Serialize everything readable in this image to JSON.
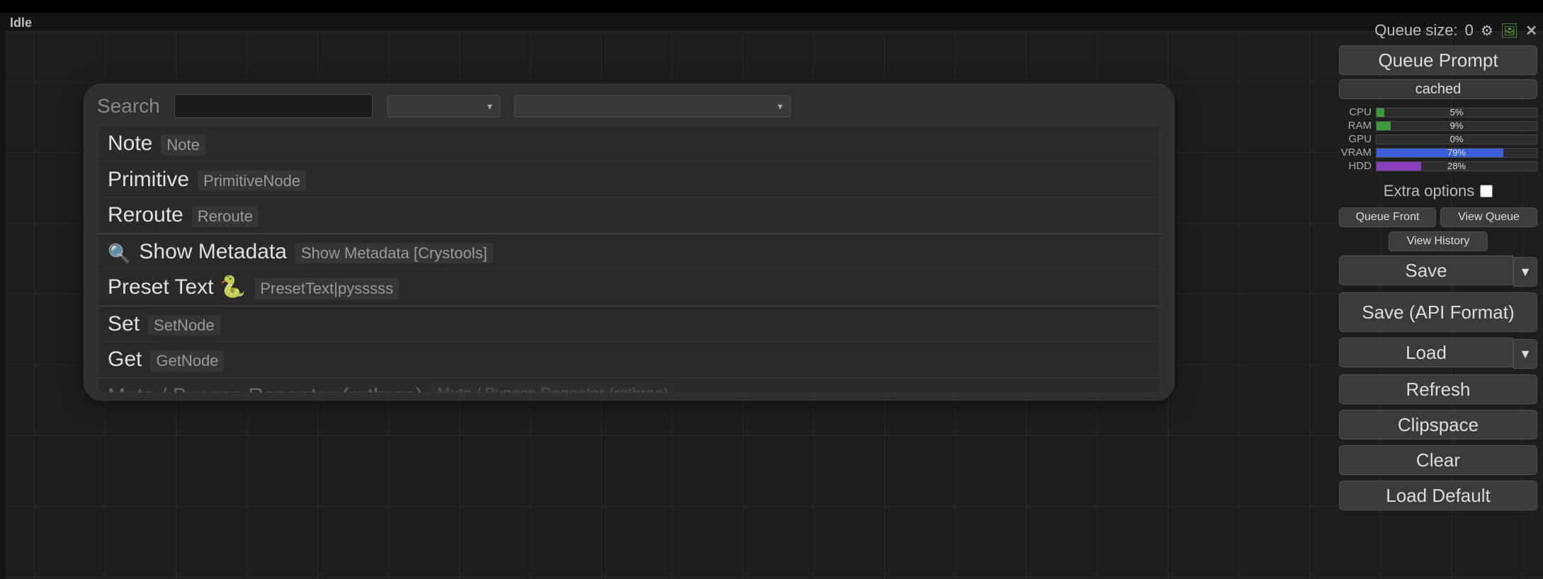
{
  "status": {
    "text": "Idle"
  },
  "search": {
    "label": "Search",
    "value": "",
    "placeholder": "",
    "results": [
      {
        "icon": "",
        "name": "Note",
        "tag": "Note",
        "divider": false
      },
      {
        "icon": "",
        "name": "Primitive",
        "tag": "PrimitiveNode",
        "divider": false
      },
      {
        "icon": "",
        "name": "Reroute",
        "tag": "Reroute",
        "divider": false
      },
      {
        "icon": "🔍",
        "name": "Show Metadata",
        "tag": "Show Metadata [Crystools]",
        "divider": true
      },
      {
        "icon": "",
        "name": "Preset Text 🐍",
        "tag": "PresetText|pysssss",
        "divider": false
      },
      {
        "icon": "",
        "name": "Set",
        "tag": "SetNode",
        "divider": true
      },
      {
        "icon": "",
        "name": "Get",
        "tag": "GetNode",
        "divider": false
      },
      {
        "icon": "",
        "name": "Mute / Bypass Repeater (rgthree)",
        "tag": "Mute / Bypass Repeater (rgthree)",
        "divider": true,
        "cut": true
      }
    ]
  },
  "panel": {
    "queue_size_label": "Queue size:",
    "queue_size_value": "0",
    "queue_prompt": "Queue Prompt",
    "cached": "cached",
    "meters": [
      {
        "label": "CPU",
        "value": "5%",
        "pct": 5,
        "color": "#3c9a3c"
      },
      {
        "label": "RAM",
        "value": "9%",
        "pct": 9,
        "color": "#3c9a3c"
      },
      {
        "label": "GPU",
        "value": "0%",
        "pct": 0,
        "color": "#3c9a3c"
      },
      {
        "label": "VRAM",
        "value": "79%",
        "pct": 79,
        "color": "#3a5ed8"
      },
      {
        "label": "HDD",
        "value": "28%",
        "pct": 28,
        "color": "#8a3fbf"
      }
    ],
    "extra_options": "Extra options",
    "queue_front": "Queue Front",
    "view_queue": "View Queue",
    "view_history": "View History",
    "save": "Save",
    "save_api": "Save (API Format)",
    "load": "Load",
    "refresh": "Refresh",
    "clipspace": "Clipspace",
    "clear": "Clear",
    "load_default": "Load Default"
  },
  "icons": {
    "gear": "⚙",
    "image": "🖼",
    "close": "✕",
    "chev": "▾",
    "tri": "▼"
  }
}
